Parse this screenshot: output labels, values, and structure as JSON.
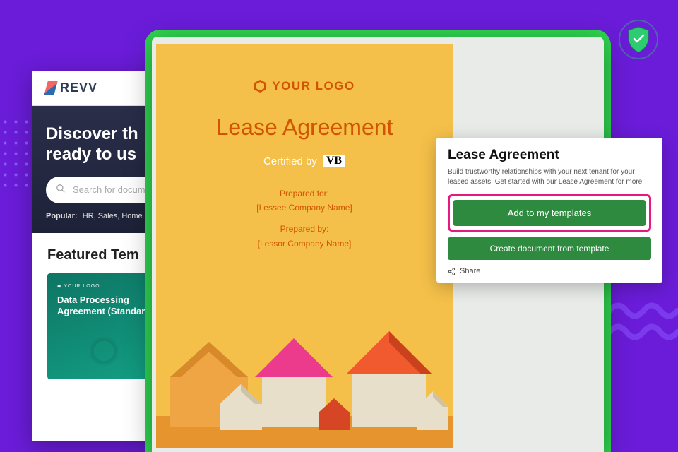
{
  "brand": {
    "name": "REVV"
  },
  "hero": {
    "title_line": "Discover th\nready to us",
    "search_placeholder": "Search for document t",
    "popular_label": "Popular:",
    "popular_items": "HR, Sales, Home In"
  },
  "featured": {
    "heading": "Featured Tem",
    "template_logo": "YOUR LOGO",
    "template_title": "Data Processing Agreement (Standard)"
  },
  "document": {
    "logo_text": "YOUR LOGO",
    "title": "Lease Agreement",
    "certified_label": "Certified by",
    "certified_mark": "VB",
    "prepared_for_label": "Prepared for:",
    "prepared_for_value": "[Lessee Company Name]",
    "prepared_by_label": "Prepared by:",
    "prepared_by_value": "[Lessor Company Name]"
  },
  "side_panel": {
    "title": "Lease Agreement",
    "description": "Build trustworthy relationships with your next tenant for your leased assets. Get started with our Lease Agreement for more.",
    "primary_button": "Add to my templates",
    "secondary_button": "Create document from template",
    "share_label": "Share"
  },
  "colors": {
    "bg": "#6a1cd8",
    "green_panel": "#2fd34f",
    "doc_bg": "#f4c049",
    "accent": "#d35400",
    "cta": "#2d8a3e",
    "highlight_ring": "#e6197f"
  }
}
